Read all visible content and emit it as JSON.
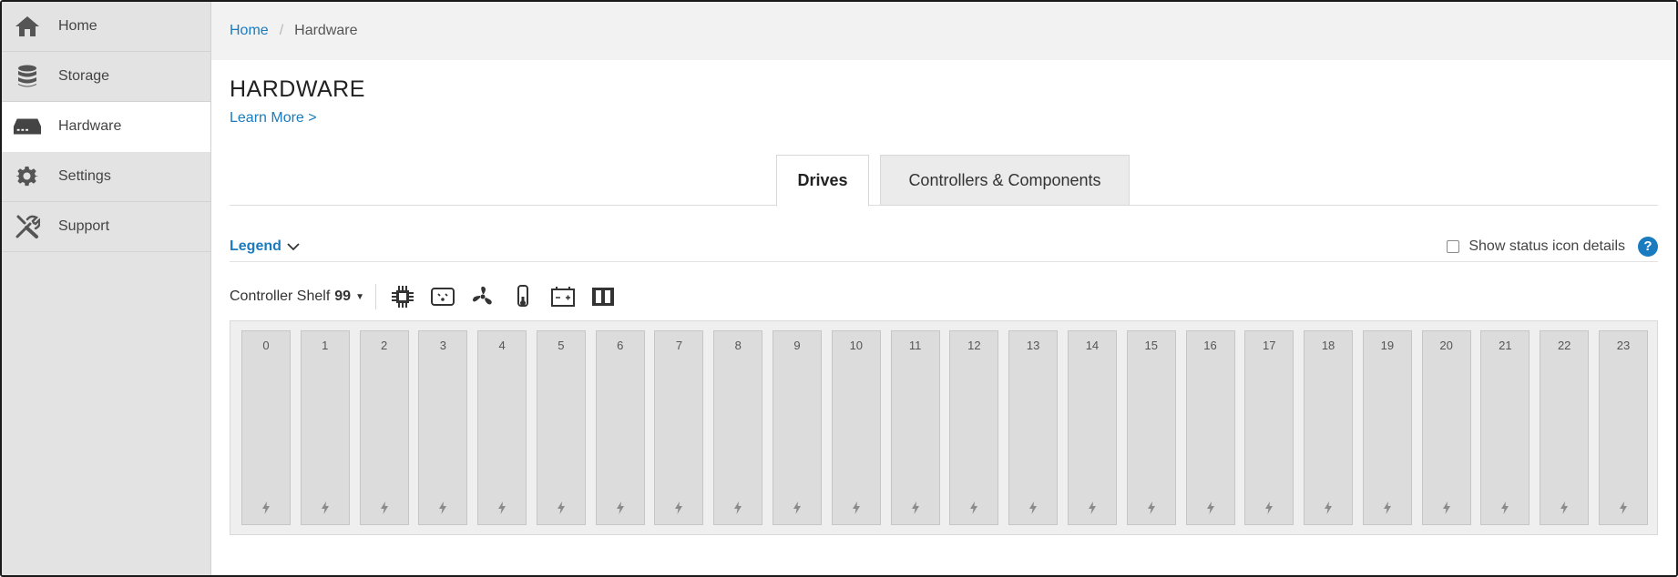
{
  "sidebar": {
    "items": [
      {
        "label": "Home",
        "icon": "home-icon"
      },
      {
        "label": "Storage",
        "icon": "database-icon"
      },
      {
        "label": "Hardware",
        "icon": "hardware-icon",
        "active": true
      },
      {
        "label": "Settings",
        "icon": "gear-icon"
      },
      {
        "label": "Support",
        "icon": "tools-icon"
      }
    ]
  },
  "breadcrumb": {
    "home": "Home",
    "separator": "/",
    "current": "Hardware"
  },
  "page": {
    "title": "HARDWARE",
    "learn_more": "Learn More >"
  },
  "tabs": [
    {
      "label": "Drives",
      "active": true
    },
    {
      "label": "Controllers & Components",
      "active": false
    }
  ],
  "legend": {
    "label": "Legend",
    "show_status_label": "Show status icon details",
    "show_status_checked": false,
    "help": "?"
  },
  "shelf": {
    "label": "Controller Shelf",
    "number": "99",
    "component_icons": [
      "chip-icon",
      "power-supply-icon",
      "fan-icon",
      "thermometer-icon",
      "battery-icon",
      "controllers-icon"
    ]
  },
  "bays": [
    "0",
    "1",
    "2",
    "3",
    "4",
    "5",
    "6",
    "7",
    "8",
    "9",
    "10",
    "11",
    "12",
    "13",
    "14",
    "15",
    "16",
    "17",
    "18",
    "19",
    "20",
    "21",
    "22",
    "23"
  ],
  "colors": {
    "link": "#1a7bbf",
    "sidebar_bg": "#e3e3e3",
    "bay_bg": "#dcdcdc"
  }
}
